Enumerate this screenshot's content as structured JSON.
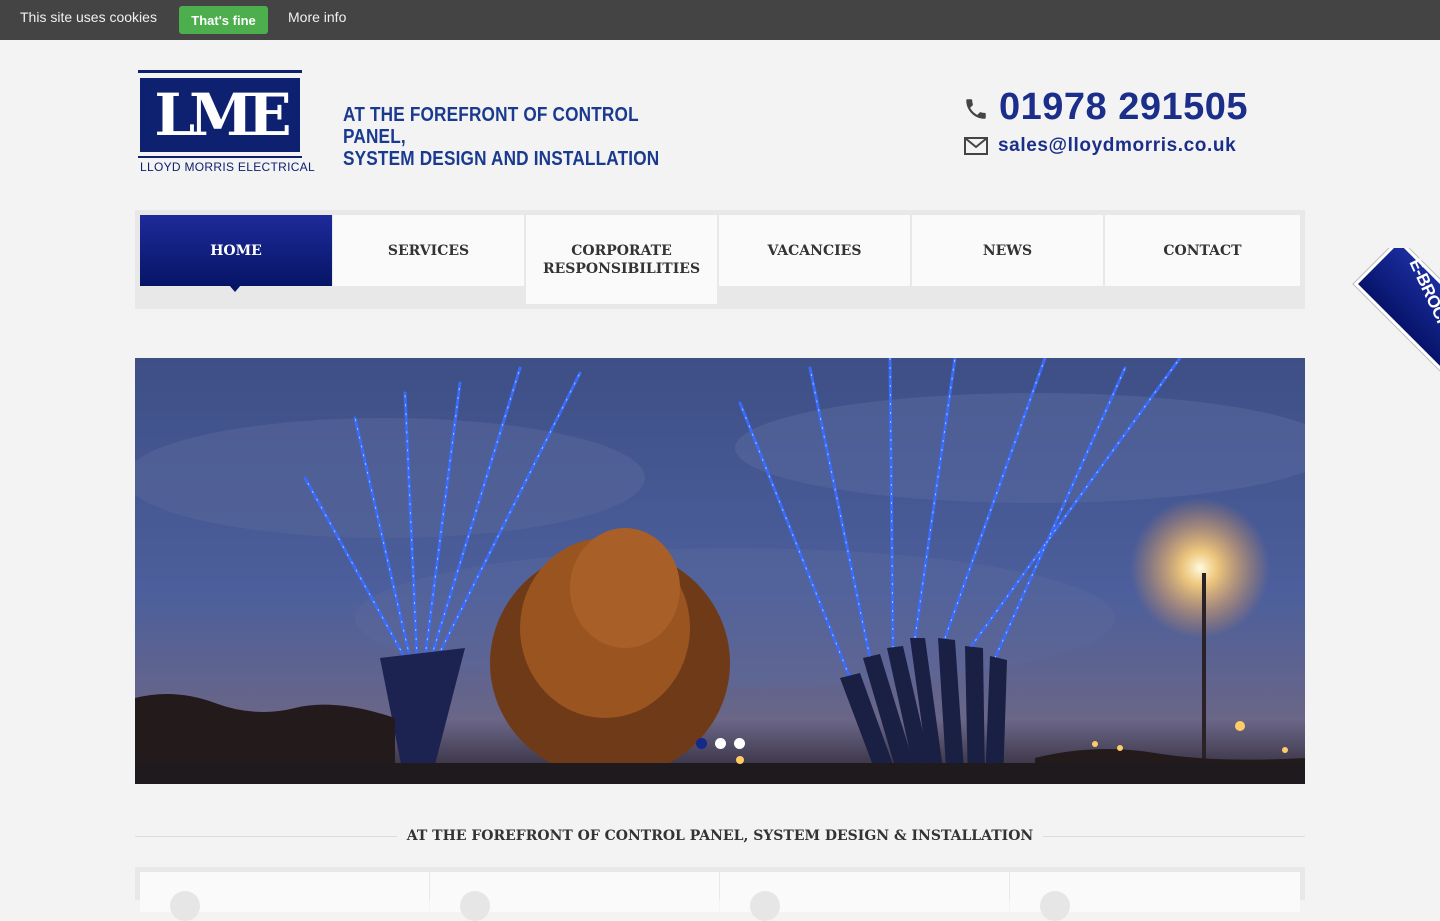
{
  "cookie_bar": {
    "message": "This site uses cookies",
    "accept_label": "That's fine",
    "more_info_label": "More info"
  },
  "header": {
    "logo_letters": "LME",
    "logo_name": "LLOYD MORRIS ELECTRICAL",
    "tagline_line1": "AT THE FOREFRONT OF CONTROL PANEL,",
    "tagline_line2": "SYSTEM DESIGN AND INSTALLATION",
    "phone": "01978 291505",
    "email": "sales@lloydmorris.co.uk"
  },
  "nav": {
    "items": [
      {
        "label": "HOME",
        "active": true
      },
      {
        "label": "SERVICES"
      },
      {
        "label": "CORPORATE RESPONSIBILITIES"
      },
      {
        "label": "VACANCIES"
      },
      {
        "label": "NEWS"
      },
      {
        "label": "CONTACT"
      }
    ]
  },
  "ebrochure": {
    "label": "E-BROCHURE"
  },
  "slider": {
    "slides": 3,
    "active_index": 0
  },
  "section": {
    "title": "AT THE FOREFRONT OF CONTROL PANEL, SYSTEM DESIGN & INSTALLATION"
  },
  "colors": {
    "brand_blue": "#0d2170",
    "accept_green": "#4cae4c",
    "cookie_bar_bg": "#444444"
  }
}
